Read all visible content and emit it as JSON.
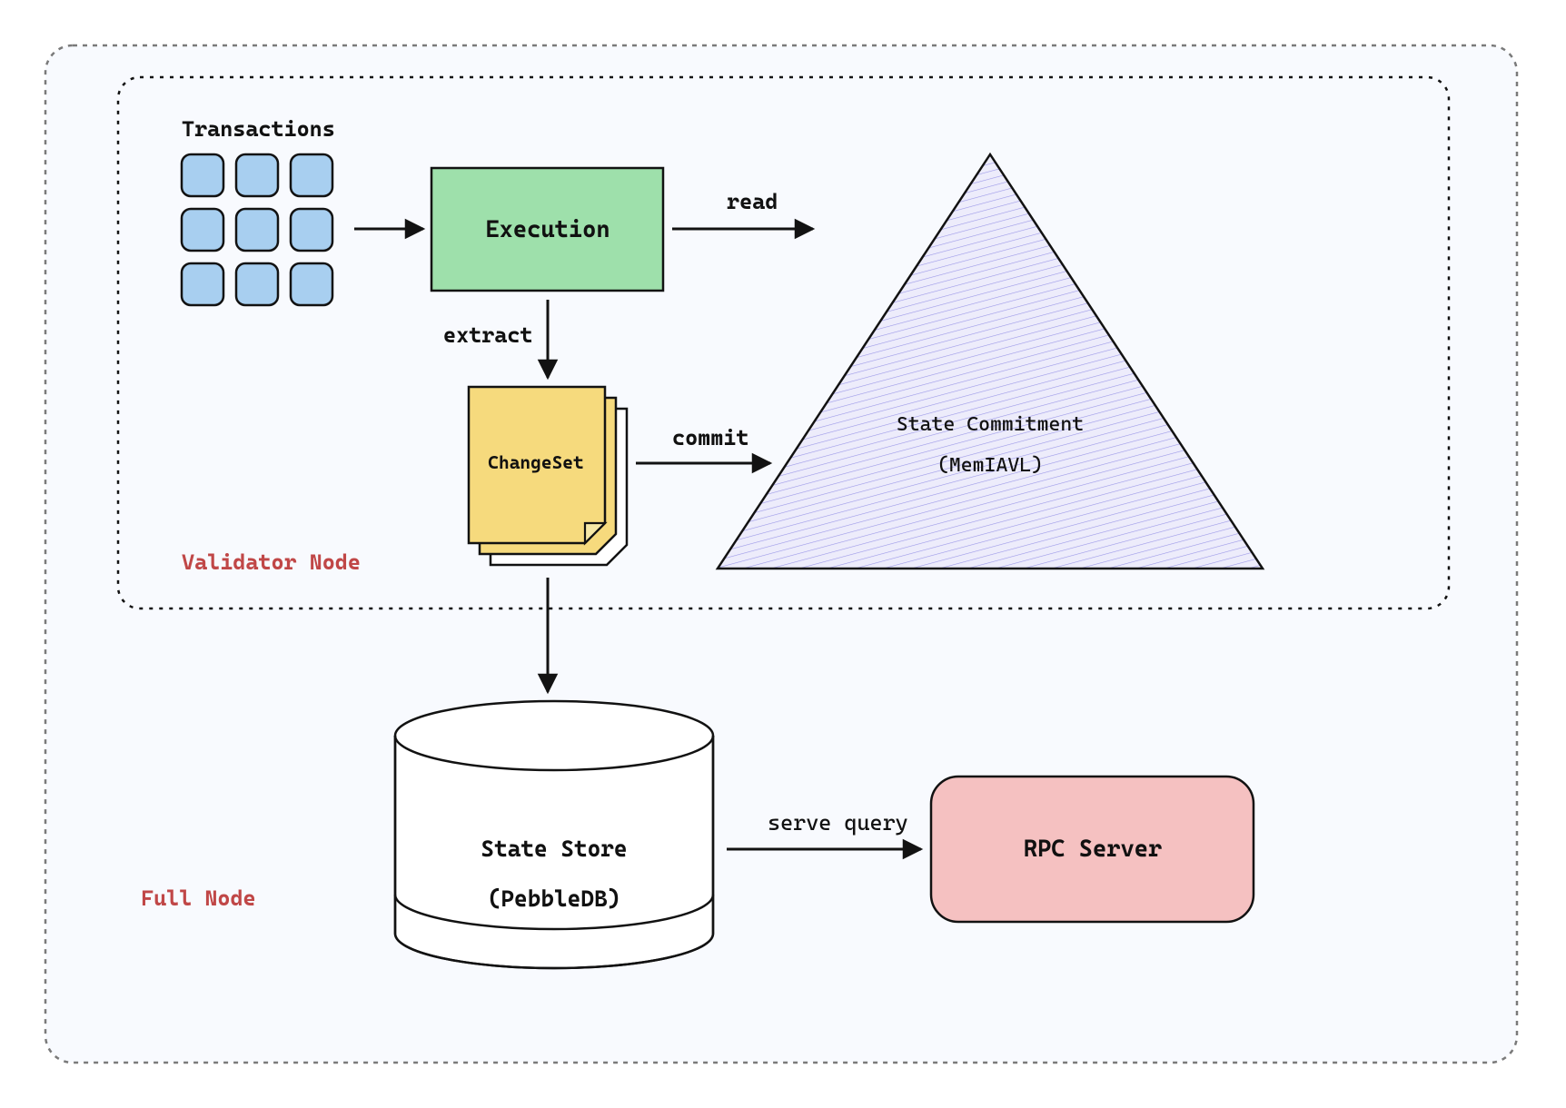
{
  "labels": {
    "transactions": "Transactions",
    "execution": "Execution",
    "read": "read",
    "extract": "extract",
    "changeset": "ChangeSet",
    "commit": "commit",
    "state_commitment_l1": "State Commitment",
    "state_commitment_l2": "(MemIAVL)",
    "validator_node": "Validator Node",
    "full_node": "Full Node",
    "state_store_l1": "State Store",
    "state_store_l2": "(PebbleDB)",
    "serve_query": "serve query",
    "rpc_server": "RPC Server"
  },
  "colors": {
    "full_node_bg": "#F8FAFE",
    "tx_fill": "#A8CFF0",
    "execution_fill": "#9EE0AB",
    "changeset_fill": "#F6DA7D",
    "triangle_fill": "#D2D0F5",
    "rpc_fill": "#F5C1C1",
    "stroke": "#121212",
    "red": "#C04747"
  }
}
